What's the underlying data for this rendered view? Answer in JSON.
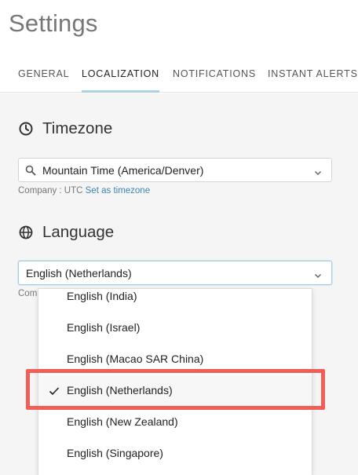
{
  "page_title": "Settings",
  "tabs": [
    {
      "label": "GENERAL"
    },
    {
      "label": "LOCALIZATION"
    },
    {
      "label": "NOTIFICATIONS"
    },
    {
      "label": "INSTANT ALERTS"
    }
  ],
  "timezone": {
    "title": "Timezone",
    "value": "Mountain Time (America/Denver)",
    "hint_prefix": "Company : UTC",
    "hint_link": "Set as timezone"
  },
  "language": {
    "title": "Language",
    "value": "English (Netherlands)",
    "hint_partial": "Com",
    "options": [
      {
        "label": "English (India)",
        "selected": false
      },
      {
        "label": "English (Israel)",
        "selected": false
      },
      {
        "label": "English (Macao SAR China)",
        "selected": false
      },
      {
        "label": "English (Netherlands)",
        "selected": true
      },
      {
        "label": "English (New Zealand)",
        "selected": false
      },
      {
        "label": "English (Singapore)",
        "selected": false
      }
    ]
  },
  "colors": {
    "accent": "#a9d0e3",
    "link": "#3b85b5",
    "highlight": "#ef5f57"
  },
  "icons": {
    "timezone": "clock-icon",
    "language": "globe-icon",
    "search": "search-icon",
    "dropdown": "chevron-down-icon",
    "selected": "check-icon"
  }
}
